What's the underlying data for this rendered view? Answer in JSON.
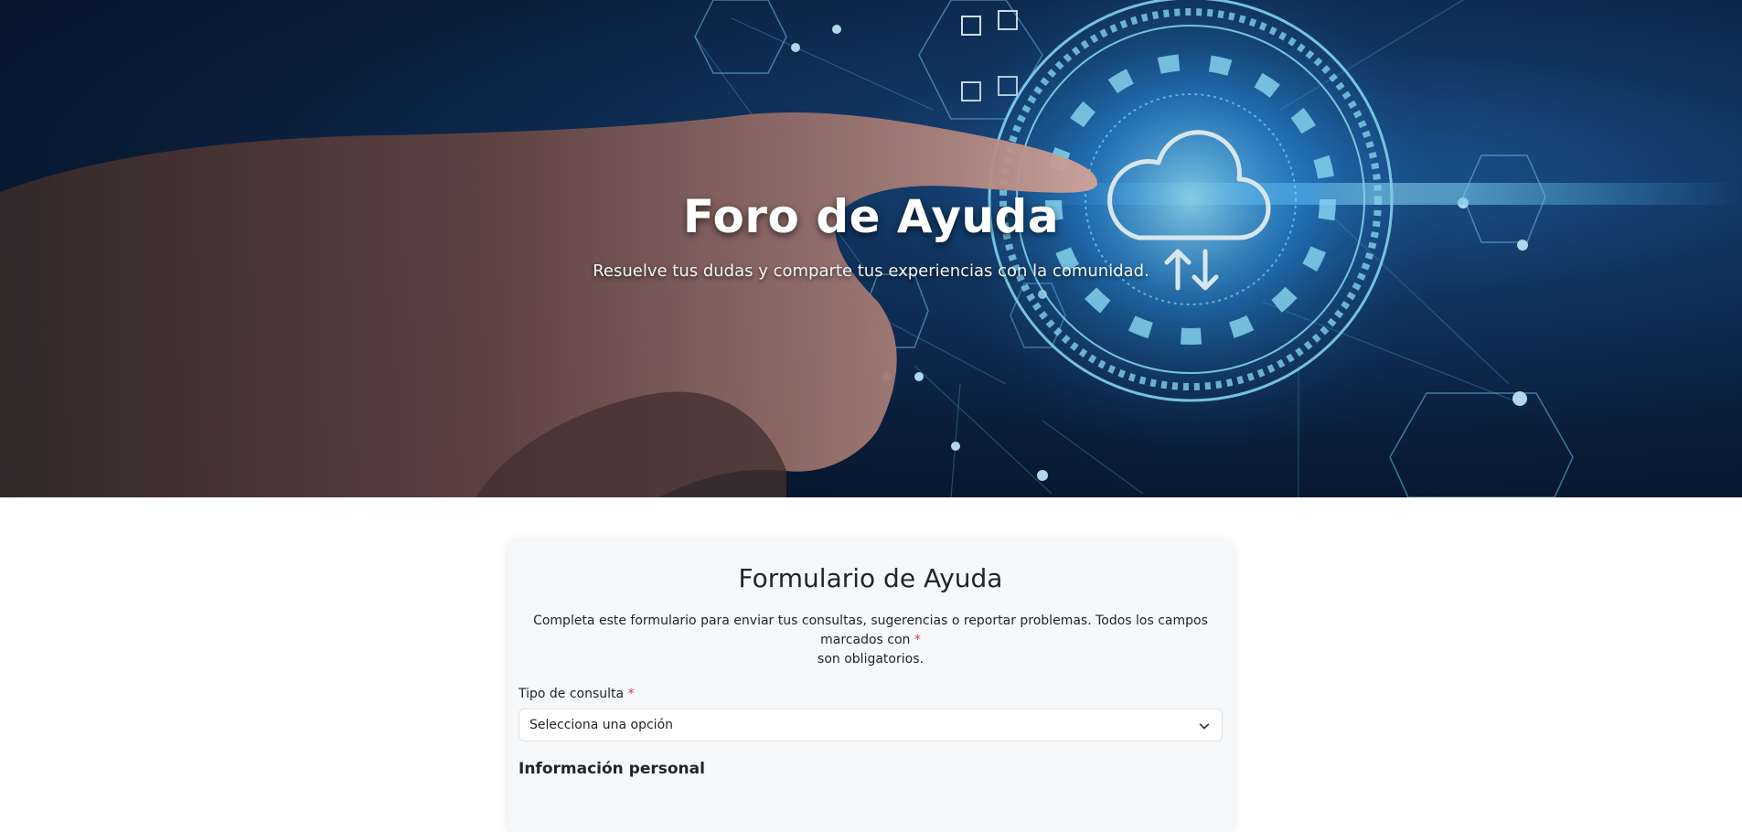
{
  "hero": {
    "title": "Foro de Ayuda",
    "subtitle": "Resuelve tus dudas y comparte tus experiencias con la comunidad."
  },
  "form": {
    "title": "Formulario de Ayuda",
    "description": "Completa este formulario para enviar tus consultas, sugerencias o reportar problemas. Todos los campos marcados con",
    "required_marker": "*",
    "description_end": "son obligatorios.",
    "tipo_consulta": {
      "label": "Tipo de consulta",
      "required_marker": "*",
      "selected": "Selecciona una opción"
    },
    "section_personal": "Información personal"
  },
  "colors": {
    "required": "#dc3545",
    "card_bg": "#f7f8fa",
    "hero_glow": "#5fd0ff"
  },
  "icons": [
    "cloud-upload-download-icon",
    "chevron-down-icon"
  ]
}
